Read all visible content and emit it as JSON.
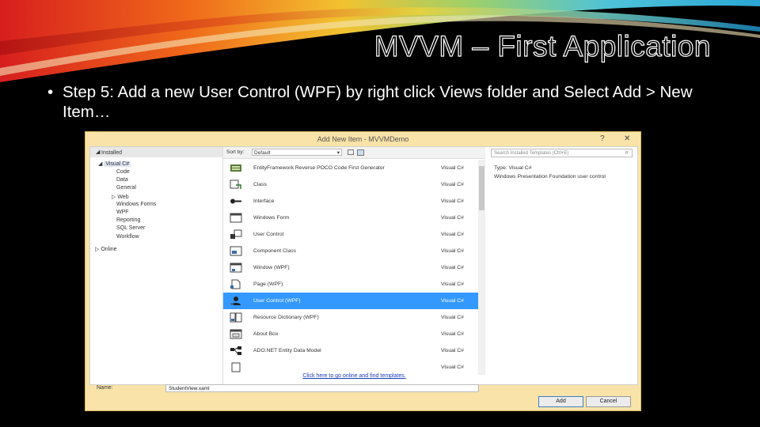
{
  "slide": {
    "title": "MVVM – First Application",
    "bullet_glyph": "•",
    "bullet_text": "Step 5: Add a new User Control (WPF) by right click Views folder and Select Add > New Item…"
  },
  "dialog": {
    "title": "Add New Item - MVVMDemo",
    "help_glyph": "?",
    "close_glyph": "✕",
    "left_pane": {
      "header": "Installed",
      "root": "Visual C#",
      "children": [
        "Code",
        "Data",
        "General",
        "Web",
        "Windows Forms",
        "WPF",
        "Reporting",
        "SQL Server",
        "Workflow"
      ],
      "online": "Online"
    },
    "toolbar": {
      "sort_label": "Sort by:",
      "sort_value": "Default"
    },
    "items": [
      {
        "name": "EntityFramework Reverse POCO Code First Generator",
        "lang": "Visual C#",
        "icon": "ef-generator-icon",
        "selected": false
      },
      {
        "name": "Class",
        "lang": "Visual C#",
        "icon": "class-icon",
        "selected": false
      },
      {
        "name": "Interface",
        "lang": "Visual C#",
        "icon": "interface-icon",
        "selected": false
      },
      {
        "name": "Windows Form",
        "lang": "Visual C#",
        "icon": "windows-form-icon",
        "selected": false
      },
      {
        "name": "User Control",
        "lang": "Visual C#",
        "icon": "user-control-icon",
        "selected": false
      },
      {
        "name": "Component Class",
        "lang": "Visual C#",
        "icon": "component-class-icon",
        "selected": false
      },
      {
        "name": "Window (WPF)",
        "lang": "Visual C#",
        "icon": "window-wpf-icon",
        "selected": false
      },
      {
        "name": "Page (WPF)",
        "lang": "Visual C#",
        "icon": "page-wpf-icon",
        "selected": false
      },
      {
        "name": "User Control (WPF)",
        "lang": "Visual C#",
        "icon": "user-control-wpf-icon",
        "selected": true
      },
      {
        "name": "Resource Dictionary (WPF)",
        "lang": "Visual C#",
        "icon": "resource-dictionary-icon",
        "selected": false
      },
      {
        "name": "About Box",
        "lang": "Visual C#",
        "icon": "about-box-icon",
        "selected": false
      },
      {
        "name": "ADO.NET Entity Data Model",
        "lang": "Visual C#",
        "icon": "entity-data-model-icon",
        "selected": false
      },
      {
        "name": "",
        "lang": "Visual C#",
        "icon": "generic-item-icon",
        "selected": false
      }
    ],
    "online_link": "Click here to go online and find templates.",
    "search_placeholder": "Search Installed Templates (Ctrl+E)",
    "details": {
      "type": "Type:  Visual C#",
      "description": "Windows Presentation Foundation user control"
    },
    "name_label": "Name:",
    "name_value": "StudentView.xaml",
    "add_button": "Add",
    "cancel_button": "Cancel"
  },
  "colors": {
    "selection": "#3399ff",
    "dialog_frame": "#f9e3a8",
    "link": "#1a3ebc"
  }
}
